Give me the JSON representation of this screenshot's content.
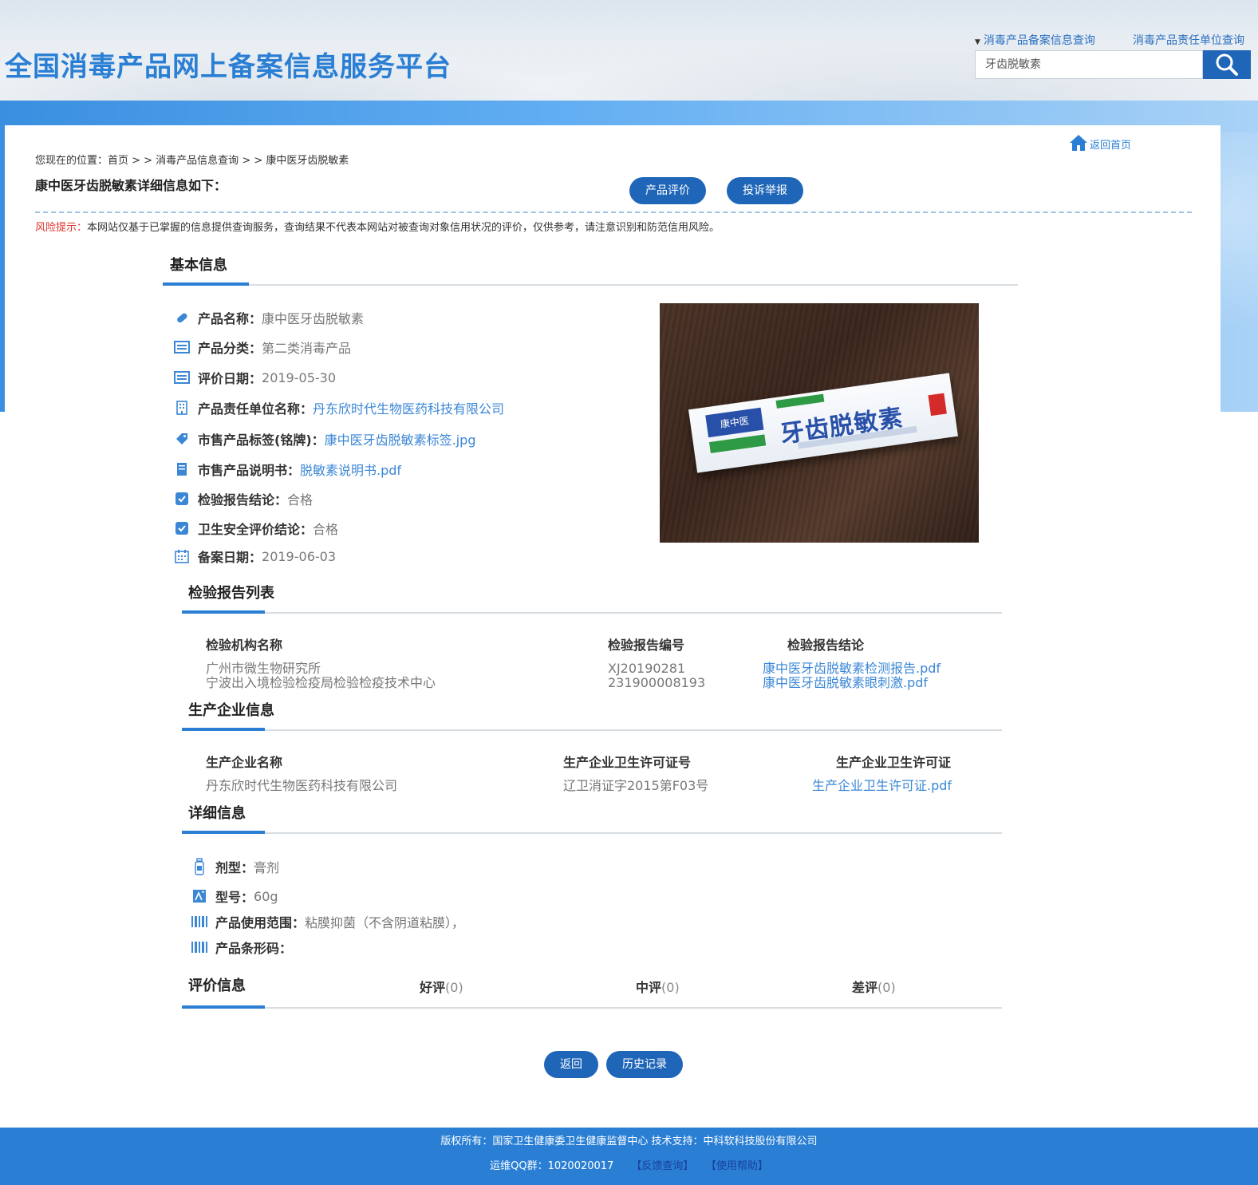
{
  "header": {
    "site_title": "全国消毒产品网上备案信息服务平台",
    "link_record_query": "消毒产品备案信息查询",
    "link_unit_query": "消毒产品责任单位查询",
    "search_value": "牙齿脱敏素"
  },
  "breadcrumb": {
    "text": "您现在的位置：首页 > > 消毒产品信息查询 > > 康中医牙齿脱敏素"
  },
  "home_link": "返回首页",
  "detail_title": "康中医牙齿脱敏素详细信息如下：",
  "buttons": {
    "rate": "产品评价",
    "complain": "投诉举报",
    "back": "返回",
    "history": "历史记录"
  },
  "risk": {
    "label": "风险提示：",
    "text": "本网站仅基于已掌握的信息提供查询服务，查询结果不代表本网站对被查询对象信用状况的评价，仅供参考，请注意识别和防范信用风险。"
  },
  "basic_info": {
    "section_title": "基本信息",
    "rows": [
      {
        "key": "产品名称：",
        "value": "康中医牙齿脱敏素",
        "icon": "pill-icon"
      },
      {
        "key": "产品分类：",
        "value": "第二类消毒产品",
        "icon": "card-icon"
      },
      {
        "key": "评价日期：",
        "value": "2019-05-30",
        "icon": "card-icon"
      },
      {
        "key": "产品责任单位名称：",
        "value": "丹东欣时代生物医药科技有限公司",
        "icon": "building-icon"
      },
      {
        "key": "市售产品标签(铭牌)：",
        "value": "康中医牙齿脱敏素标签.jpg",
        "icon": "tag-icon"
      },
      {
        "key": "市售产品说明书：",
        "value": "脱敏素说明书.pdf",
        "icon": "manual-icon"
      },
      {
        "key": "检验报告结论：",
        "value": "合格",
        "icon": "check-badge-icon"
      },
      {
        "key": "卫生安全评价结论：",
        "value": "合格",
        "icon": "check-badge-icon"
      },
      {
        "key": "备案日期：",
        "value": "2019-06-03",
        "icon": "calendar-icon"
      }
    ]
  },
  "report_list": {
    "section_title": "检验报告列表",
    "headers": [
      "检验机构名称",
      "检验报告编号",
      "检验报告结论"
    ],
    "rows": [
      {
        "org": "广州市微生物研究所",
        "no": "XJ20190281",
        "file": "康中医牙齿脱敏素检测报告.pdf"
      },
      {
        "org": "宁波出入境检验检疫局检验检疫技术中心",
        "no": "231900008193",
        "file": "康中医牙齿脱敏素眼刺激.pdf"
      }
    ]
  },
  "producer": {
    "section_title": "生产企业信息",
    "headers": [
      "生产企业名称",
      "生产企业卫生许可证号",
      "生产企业卫生许可证"
    ],
    "name": "丹东欣时代生物医药科技有限公司",
    "license_no": "辽卫消证字2015第F03号",
    "license_file": "生产企业卫生许可证.pdf"
  },
  "details": {
    "section_title": "详细信息",
    "rows": [
      {
        "key": "剂型：",
        "value": "膏剂",
        "icon": "bottle-icon"
      },
      {
        "key": "型号：",
        "value": "60g",
        "icon": "model-icon"
      },
      {
        "key": "产品使用范围：",
        "value": "粘膜抑菌（不含阴道粘膜），",
        "icon": "barcode-icon"
      },
      {
        "key": "产品条形码：",
        "value": "",
        "icon": "barcode-icon"
      }
    ]
  },
  "reviews": {
    "section_title": "评价信息",
    "good_label": "好评",
    "good_count": "(0)",
    "mid_label": "中评",
    "mid_count": "(0)",
    "bad_label": "差评",
    "bad_count": "(0)"
  },
  "product_image": {
    "brand": "康中医",
    "name": "牙齿脱敏素"
  },
  "footer": {
    "copyright": "版权所有：国家卫生健康委卫生健康监督中心  技术支持：中科软科技股份有限公司",
    "qq": "运维QQ群：1020020017",
    "feedback": "【反馈查询】",
    "help": "【使用帮助】"
  },
  "colors": {
    "accent": "#2a7fd4",
    "button": "#1f66b8",
    "link": "#3b87d6",
    "risk": "#e0302b"
  }
}
